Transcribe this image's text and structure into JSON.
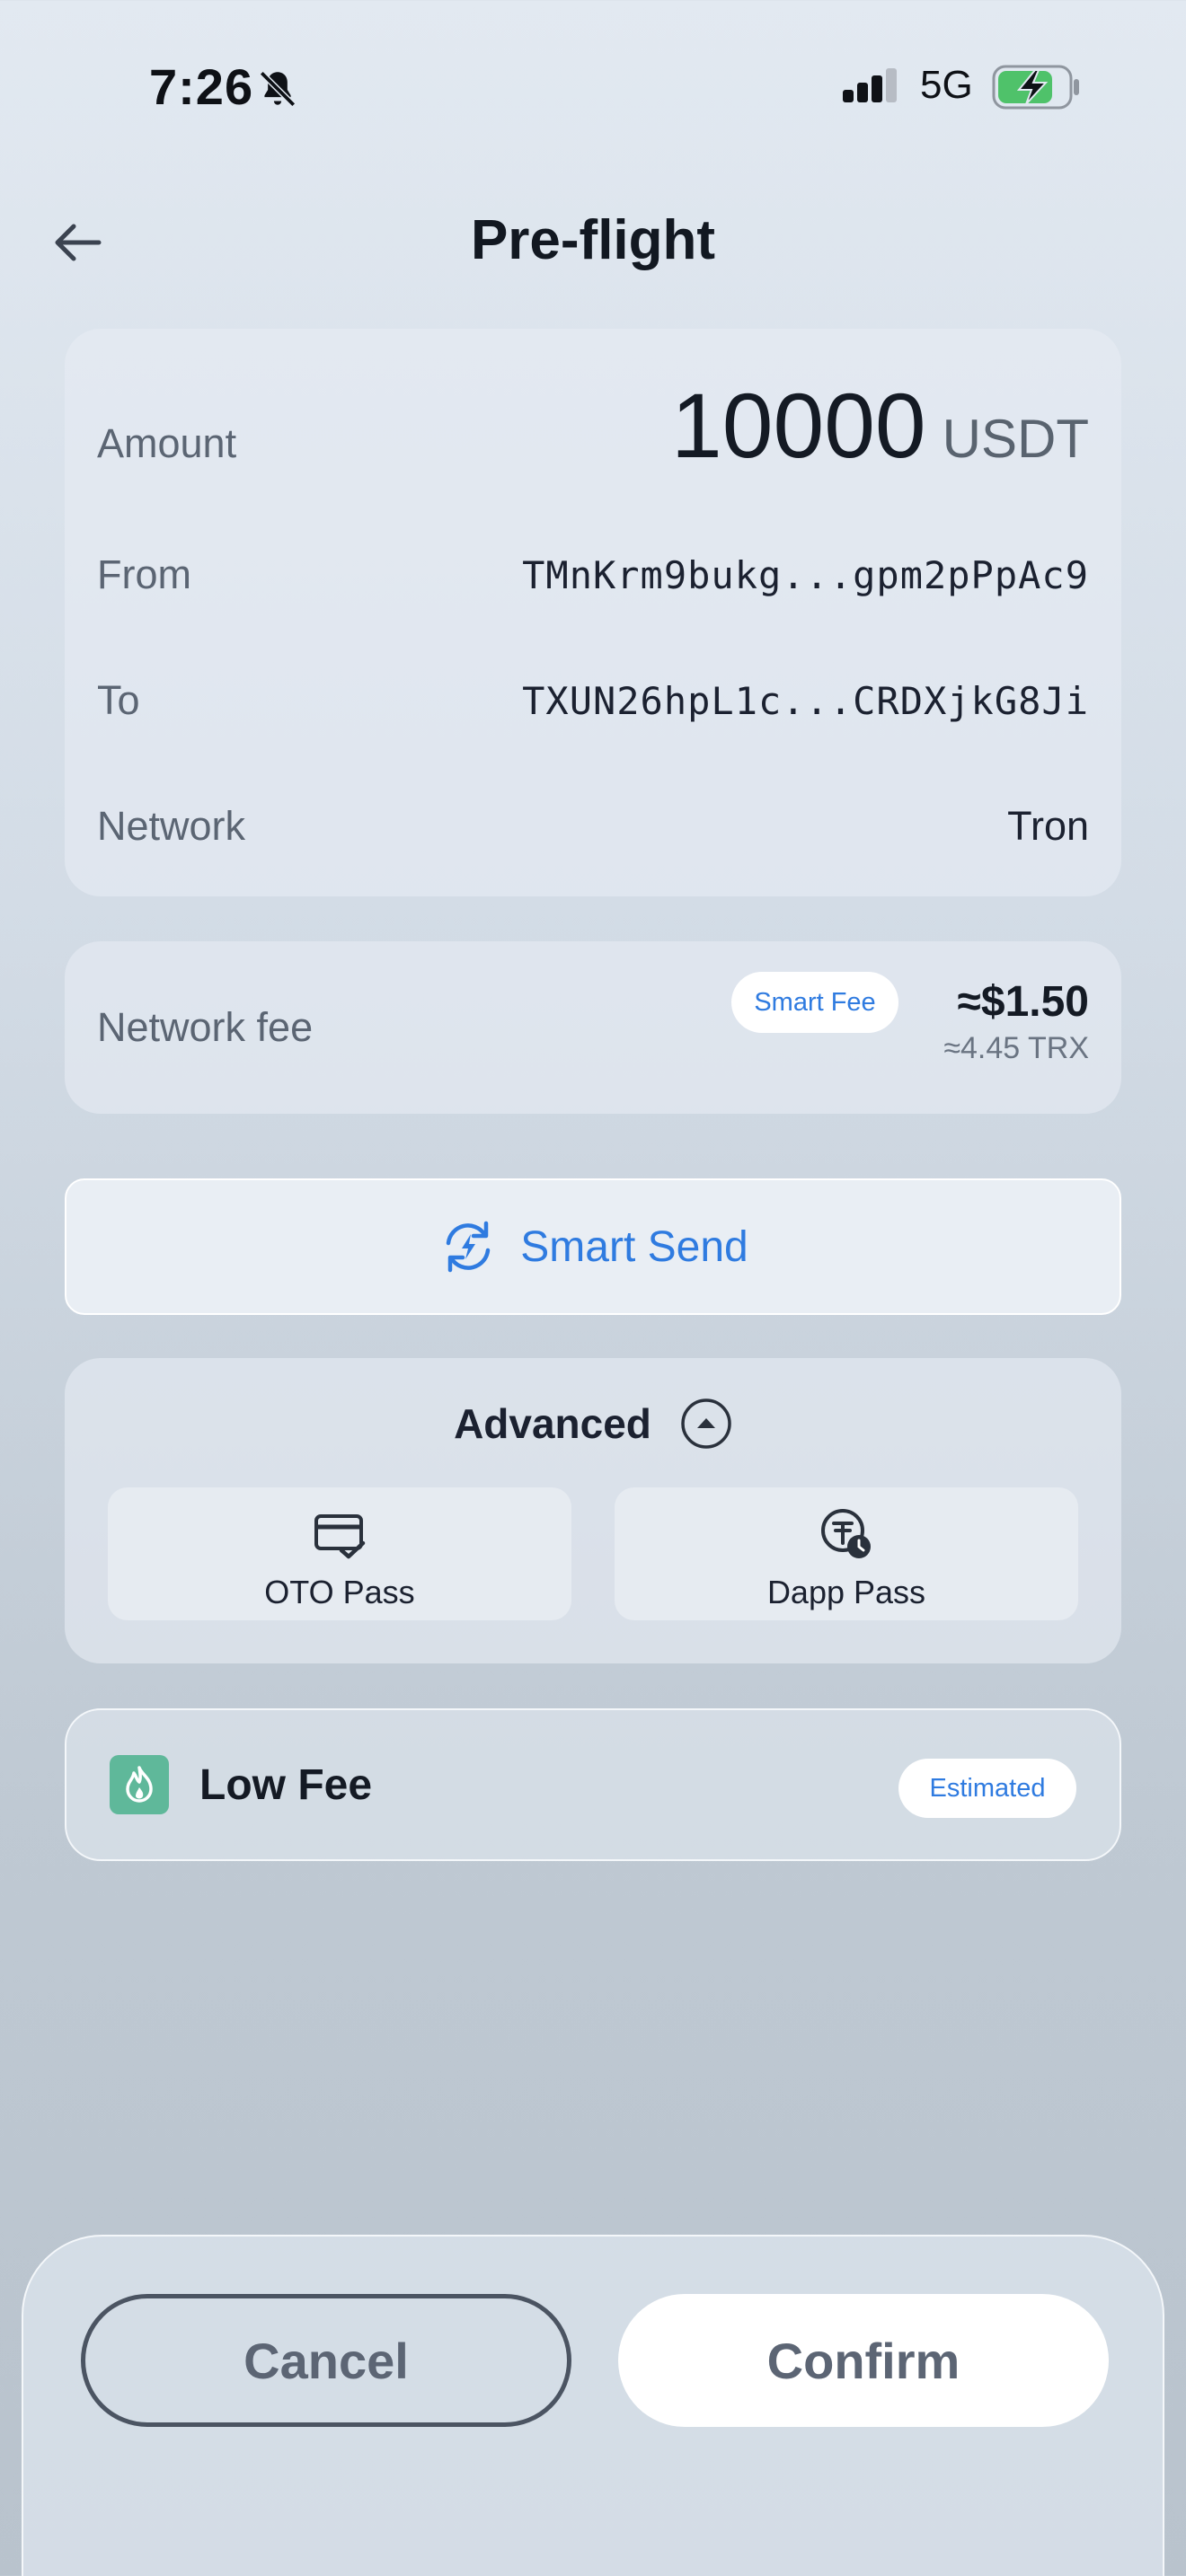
{
  "status_bar": {
    "time": "7:26",
    "network": "5G",
    "icons": [
      "bell-slash-icon",
      "signal-icon",
      "battery-charging-icon"
    ]
  },
  "header": {
    "title": "Pre-flight",
    "back_icon": "arrow-left-icon"
  },
  "details": {
    "amount_label": "Amount",
    "amount_value": "10000",
    "amount_unit": "USDT",
    "from_label": "From",
    "from_value": "TMnKrm9bukg...gpm2pPpAc9",
    "to_label": "To",
    "to_value": "TXUN26hpL1c...CRDXjkG8Ji",
    "network_label": "Network",
    "network_value": "Tron"
  },
  "fee": {
    "label": "Network fee",
    "badge": "Smart Fee",
    "usd": "≈$1.50",
    "trx": "≈4.45 TRX"
  },
  "smart_send": {
    "label": "Smart Send",
    "icon": "refresh-bolt-icon"
  },
  "advanced": {
    "title": "Advanced",
    "toggle_icon": "chevron-up-circle-icon",
    "options": [
      {
        "label": "OTO Pass",
        "icon": "card-check-icon"
      },
      {
        "label": "Dapp Pass",
        "icon": "token-clock-icon"
      }
    ]
  },
  "low_fee": {
    "label": "Low Fee",
    "badge": "Estimated",
    "icon": "flame-icon"
  },
  "actions": {
    "cancel": "Cancel",
    "confirm": "Confirm"
  },
  "colors": {
    "accent": "#2f7be0",
    "low_fee_icon_bg": "#5fb89a",
    "battery_fill": "#4fc26a"
  }
}
